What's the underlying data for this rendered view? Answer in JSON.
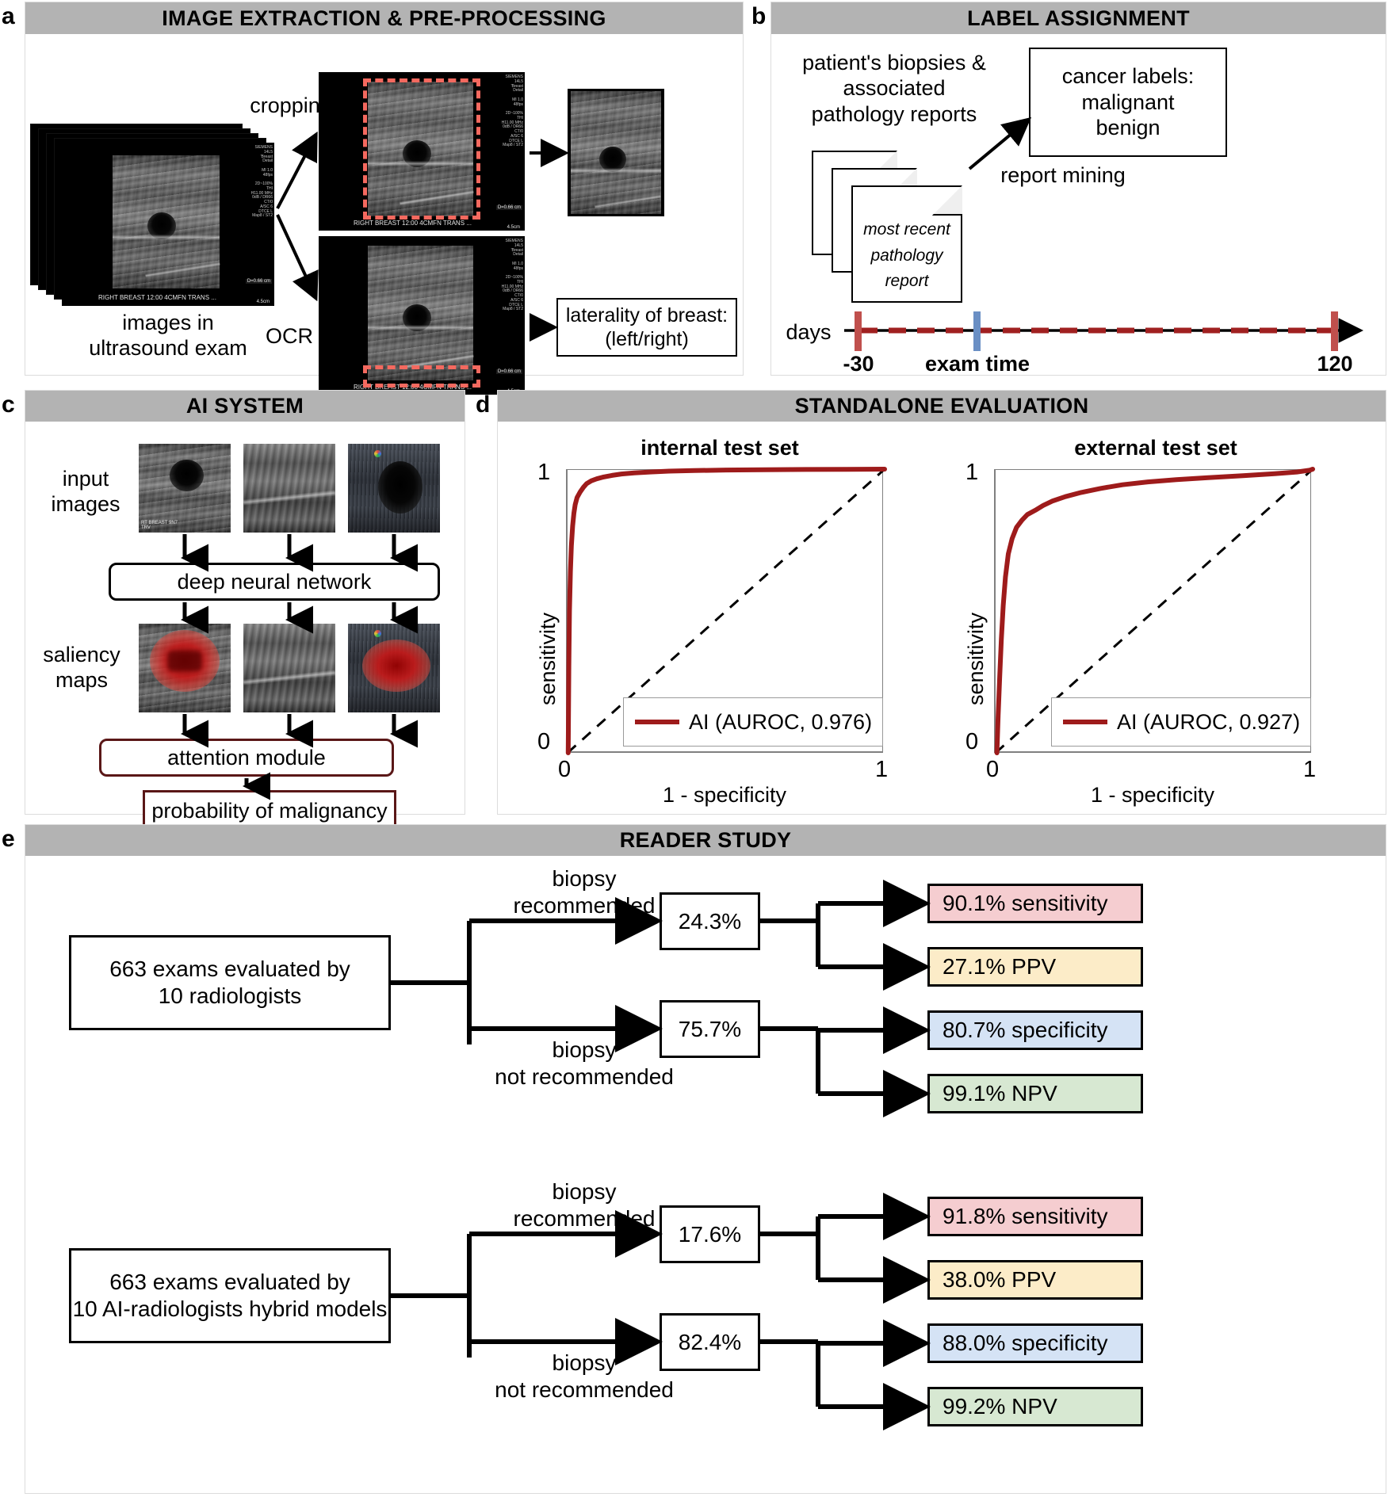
{
  "panels": {
    "a": {
      "letter": "a",
      "title": "IMAGE EXTRACTION & PRE-PROCESSING",
      "labels": {
        "cropping": "cropping",
        "ocr": "OCR",
        "images_in": "images in",
        "ultrasound_exam": "ultrasound exam",
        "laterality_line1": "laterality of breast:",
        "laterality_line2": "(left/right)"
      },
      "ultrasound_overlay": {
        "caption": "RIGHT BREAST 12:00 4CMFN TRANS ...",
        "depth": "D=0.66 cm",
        "scale": "4.5cm",
        "sidebar": "SIEMENS\n14L5\n'Breast\nDetail\n\nMI 1.0\n48fps\n\n2D~100%\nTHI\nH11.00 MHz\n0dB / DR66\nCT/0\nA/SC 6\nDTCE L\nMap8 / ST2"
      }
    },
    "b": {
      "letter": "b",
      "title": "LABEL ASSIGNMENT",
      "labels": {
        "biopsies_line1": "patient's biopsies &",
        "biopsies_line2": "associated",
        "biopsies_line3": "pathology reports",
        "report_mining": "report mining",
        "days": "days"
      },
      "cancer_labels_box": {
        "line1": "cancer labels:",
        "line2": "malignant",
        "line3": "benign"
      },
      "document": {
        "line1": "most recent",
        "line2": "pathology",
        "line3": "report"
      },
      "timeline": {
        "start_label": "-30",
        "mid_label": "exam time",
        "end_label": "120",
        "start_color": "#c0504d",
        "mid_color": "#6a8fc4",
        "range_color": "#a02020"
      }
    },
    "c": {
      "letter": "c",
      "title": "AI SYSTEM",
      "labels": {
        "input_images_line1": "input",
        "input_images_line2": "images",
        "saliency_line1": "saliency",
        "saliency_line2": "maps",
        "dnn": "deep neural network",
        "attention": "attention module",
        "probability": "probability of malignancy"
      },
      "image_caption": "RT BREAST 9N7\nTRV",
      "accent_color": "#5a1717"
    },
    "d": {
      "letter": "d",
      "title": "STANDALONE EVALUATION"
    },
    "e": {
      "letter": "e",
      "title": "READER STUDY",
      "rows": [
        {
          "source_line1": "663 exams evaluated by",
          "source_line2": "10 radiologists",
          "branch_top_line1": "biopsy",
          "branch_top_line2": "recommended",
          "branch_bottom_line1": "biopsy",
          "branch_bottom_line2": "not recommended",
          "pct_top": "24.3%",
          "pct_bottom": "75.7%",
          "results": [
            {
              "text": "90.1% sensitivity",
              "color": "#f5cdd0"
            },
            {
              "text": "27.1% PPV",
              "color": "#fcecc8"
            },
            {
              "text": "80.7% specificity",
              "color": "#d5e3f5"
            },
            {
              "text": "99.1% NPV",
              "color": "#d7e8d2"
            }
          ]
        },
        {
          "source_line1": "663 exams evaluated by",
          "source_line2": "10 AI-radiologists hybrid models",
          "branch_top_line1": "biopsy",
          "branch_top_line2": "recommended",
          "branch_bottom_line1": "biopsy",
          "branch_bottom_line2": "not recommended",
          "pct_top": "17.6%",
          "pct_bottom": "82.4%",
          "results": [
            {
              "text": "91.8% sensitivity",
              "color": "#f5cdd0"
            },
            {
              "text": "38.0% PPV",
              "color": "#fcecc8"
            },
            {
              "text": "88.0% specificity",
              "color": "#d5e3f5"
            },
            {
              "text": "99.2% NPV",
              "color": "#d7e8d2"
            }
          ]
        }
      ]
    }
  },
  "chart_data": [
    {
      "type": "line",
      "title": "internal test set",
      "xlabel": "1 - specificity",
      "ylabel": "sensitivity",
      "xlim": [
        0,
        1
      ],
      "ylim": [
        0,
        1
      ],
      "xticks": [
        "0",
        "1"
      ],
      "yticks": [
        "0",
        "1"
      ],
      "grid": false,
      "legend_position": "bottom-right",
      "series": [
        {
          "name": "AI (AUROC, 0.976)",
          "color": "#9e1b1b",
          "auroc": 0.976,
          "x": [
            0,
            0.002,
            0.004,
            0.007,
            0.01,
            0.014,
            0.018,
            0.023,
            0.03,
            0.038,
            0.048,
            0.06,
            0.075,
            0.092,
            0.112,
            0.14,
            0.17,
            0.21,
            0.26,
            0.32,
            0.4,
            0.5,
            0.62,
            0.75,
            0.88,
            1.0
          ],
          "y": [
            0,
            0.3,
            0.5,
            0.64,
            0.73,
            0.8,
            0.845,
            0.875,
            0.9,
            0.92,
            0.936,
            0.949,
            0.959,
            0.966,
            0.972,
            0.978,
            0.983,
            0.987,
            0.99,
            0.993,
            0.995,
            0.997,
            0.998,
            0.999,
            0.9995,
            1.0
          ]
        },
        {
          "name": "chance",
          "color": "#000000",
          "style": "dashed",
          "x": [
            0,
            1
          ],
          "y": [
            0,
            1
          ]
        }
      ]
    },
    {
      "type": "line",
      "title": "external test set",
      "xlabel": "1 - specificity",
      "ylabel": "sensitivity",
      "xlim": [
        0,
        1
      ],
      "ylim": [
        0,
        1
      ],
      "xticks": [
        "0",
        "1"
      ],
      "yticks": [
        "0",
        "1"
      ],
      "grid": false,
      "legend_position": "bottom-right",
      "series": [
        {
          "name": "AI (AUROC, 0.927)",
          "color": "#9e1b1b",
          "auroc": 0.927,
          "x": [
            0,
            0.004,
            0.008,
            0.013,
            0.018,
            0.024,
            0.031,
            0.04,
            0.052,
            0.066,
            0.083,
            0.1,
            0.125,
            0.15,
            0.18,
            0.22,
            0.27,
            0.33,
            0.4,
            0.48,
            0.57,
            0.67,
            0.78,
            0.88,
            0.95,
            1.0
          ],
          "y": [
            0,
            0.13,
            0.27,
            0.4,
            0.52,
            0.62,
            0.7,
            0.755,
            0.795,
            0.82,
            0.84,
            0.855,
            0.872,
            0.888,
            0.903,
            0.918,
            0.932,
            0.945,
            0.955,
            0.963,
            0.97,
            0.977,
            0.984,
            0.99,
            0.996,
            1.0
          ]
        },
        {
          "name": "chance",
          "color": "#000000",
          "style": "dashed",
          "x": [
            0,
            1
          ],
          "y": [
            0,
            1
          ]
        }
      ]
    }
  ]
}
